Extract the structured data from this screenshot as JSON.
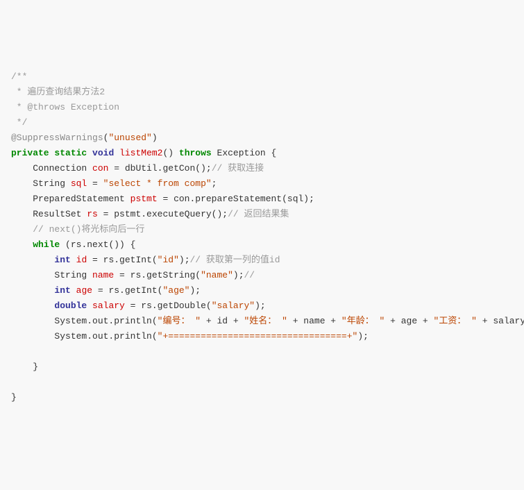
{
  "code": {
    "l1": "/**",
    "l2": " * 遍历查询结果方法2",
    "l3": " * @throws Exception",
    "l4": " */",
    "l5a": "@SuppressWarnings",
    "l5b": "(",
    "l5c": "\"unused\"",
    "l5d": ")",
    "l6a": "private",
    "l6b": "static",
    "l6c": "void",
    "l6d": "listMem2",
    "l6e": "() ",
    "l6f": "throws",
    "l6g": " Exception {",
    "l7a": "Connection ",
    "l7b": "con",
    "l7c": " = dbUtil.getCon();",
    "l7d": "// 获取连接",
    "l8a": "String ",
    "l8b": "sql",
    "l8c": " = ",
    "l8d": "\"select * from comp\"",
    "l8e": ";",
    "l9a": "PreparedStatement ",
    "l9b": "pstmt",
    "l9c": " = con.prepareStatement(sql);",
    "l10a": "ResultSet ",
    "l10b": "rs",
    "l10c": " = pstmt.executeQuery();",
    "l10d": "// 返回结果集",
    "l11": "// next()将光标向后一行",
    "l12a": "while",
    "l12b": " (rs.next()) {",
    "l13a": "int",
    "l13b": "id",
    "l13c": " = rs.getInt(",
    "l13d": "\"id\"",
    "l13e": ");",
    "l13f": "// 获取第一列的值id",
    "l14a": "String ",
    "l14b": "name",
    "l14c": " = rs.getString(",
    "l14d": "\"name\"",
    "l14e": ");",
    "l14f": "//",
    "l15a": "int",
    "l15b": "age",
    "l15c": " = rs.getInt(",
    "l15d": "\"age\"",
    "l15e": ");",
    "l16a": "double",
    "l16b": "salary",
    "l16c": " = rs.getDouble(",
    "l16d": "\"salary\"",
    "l16e": ");",
    "l17a": "System.out.println(",
    "l17b": "\"编号： \"",
    "l17c": " + id + ",
    "l17d": "\"姓名： \"",
    "l17e": " + name + ",
    "l17f": "\"年龄： \"",
    "l17g": " + age + ",
    "l17h": "\"工资： \"",
    "l17i": " + salary);",
    "l18a": "System.out.println(",
    "l18b": "\"+=================================+\"",
    "l18c": ");",
    "l19": "}",
    "l20": "}"
  }
}
